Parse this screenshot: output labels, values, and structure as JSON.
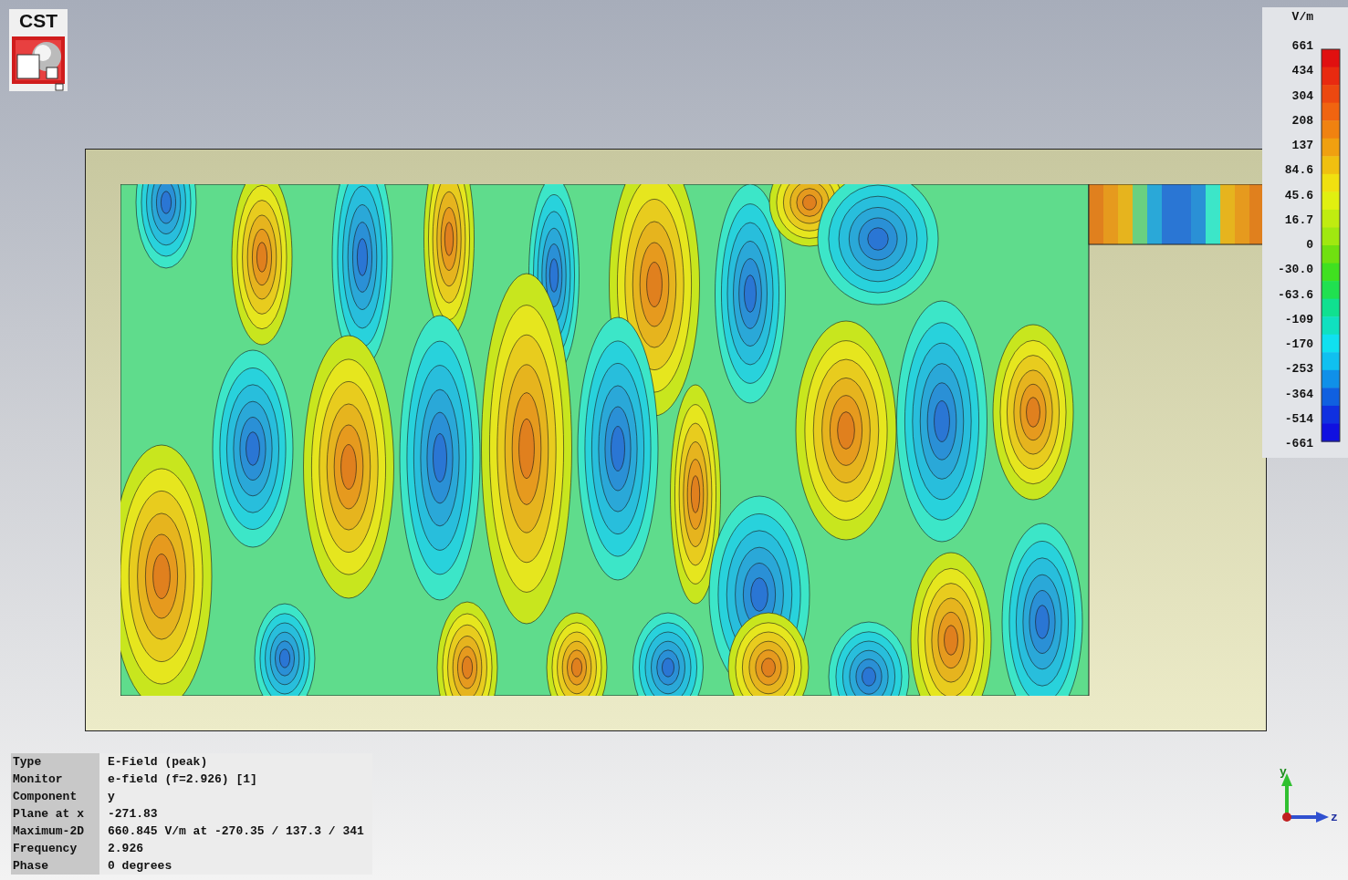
{
  "logo": {
    "text": "CST"
  },
  "legend": {
    "unit": "V/m",
    "labels": [
      "661",
      "434",
      "304",
      "208",
      "137",
      "84.6",
      "45.6",
      "16.7",
      "0",
      "-30.0",
      "-63.6",
      "-109",
      "-170",
      "-253",
      "-364",
      "-514",
      "-661"
    ]
  },
  "info": [
    {
      "label": "Type",
      "value": "E-Field (peak)"
    },
    {
      "label": "Monitor",
      "value": "e-field (f=2.926) [1]"
    },
    {
      "label": "Component",
      "value": "y"
    },
    {
      "label": "Plane at x",
      "value": "-271.83"
    },
    {
      "label": "Maximum-2D",
      "value": "660.845 V/m at -270.35 / 137.3 / 341"
    },
    {
      "label": "Frequency",
      "value": "2.926"
    },
    {
      "label": "Phase",
      "value": "0 degrees"
    }
  ],
  "axes": {
    "vertical": "y",
    "horizontal": "z"
  }
}
